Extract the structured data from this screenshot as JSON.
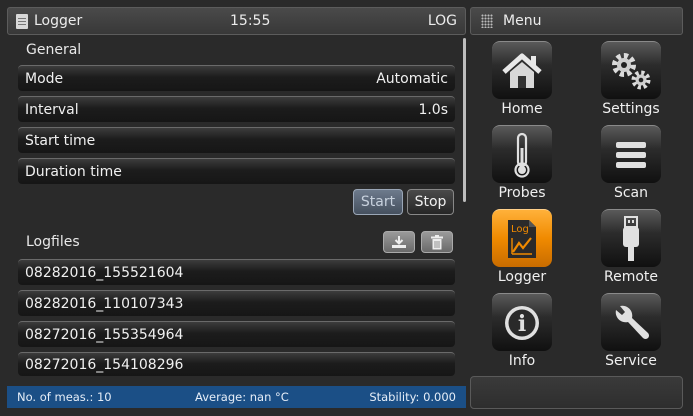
{
  "titlebar": {
    "title": "Logger",
    "time": "15:55",
    "mode": "LOG",
    "menu_title": "Menu"
  },
  "general": {
    "label": "General",
    "rows": [
      {
        "label": "Mode",
        "value": "Automatic"
      },
      {
        "label": "Interval",
        "value": "1.0s"
      },
      {
        "label": "Start time",
        "value": ""
      },
      {
        "label": "Duration time",
        "value": ""
      }
    ],
    "start_label": "Start",
    "stop_label": "Stop"
  },
  "logfiles": {
    "label": "Logfiles",
    "files": [
      "08282016_155521604",
      "08282016_110107343",
      "08272016_155354964",
      "08272016_154108296"
    ]
  },
  "status": {
    "measurements": "No. of meas.: 10",
    "average": "Average: nan °C",
    "stability": "Stability: 0.000"
  },
  "menu": {
    "items": [
      {
        "label": "Home",
        "icon": "house-icon"
      },
      {
        "label": "Settings",
        "icon": "gears-icon"
      },
      {
        "label": "Probes",
        "icon": "thermometer-icon"
      },
      {
        "label": "Scan",
        "icon": "stack-icon"
      },
      {
        "label": "Logger",
        "icon": "log-file-icon",
        "icon_text": "Log",
        "active": true
      },
      {
        "label": "Remote",
        "icon": "usb-plug-icon"
      },
      {
        "label": "Info",
        "icon": "info-icon",
        "icon_text": "i"
      },
      {
        "label": "Service",
        "icon": "wrench-icon"
      }
    ]
  },
  "colors": {
    "active_accent": "#f08a00",
    "status_bar": "#1b4f86"
  }
}
